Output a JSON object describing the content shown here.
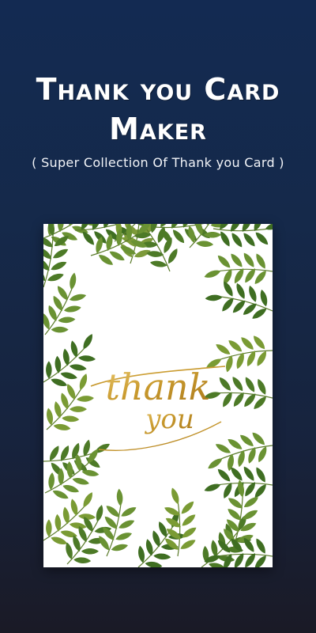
{
  "header": {
    "title_line1": "Thank you Card",
    "title_line2": "Maker",
    "subtitle": "( Super Collection Of Thank you Card )"
  },
  "card": {
    "script_line1": "thank",
    "script_line2": "you",
    "leaf_color": "#5f8a2e",
    "leaf_dark": "#2f5e1f",
    "gold": "#c99a2e"
  }
}
